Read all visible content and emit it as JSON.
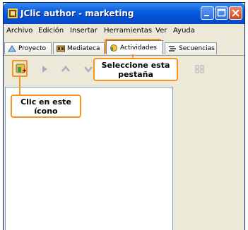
{
  "window": {
    "title": "JClic author - marketing",
    "colors": {
      "titlebar": "#0a5ee0",
      "accent": "#f7941d",
      "face": "#ece9d8"
    }
  },
  "menu": [
    "Archivo",
    "Edición",
    "Insertar",
    "Herramientas",
    "Ver",
    "Ayuda"
  ],
  "tabs": [
    {
      "label": "Proyecto",
      "icon": "project-icon",
      "active": false
    },
    {
      "label": "Mediateca",
      "icon": "media-library-icon",
      "active": false
    },
    {
      "label": "Actividades",
      "icon": "activities-icon",
      "active": true
    },
    {
      "label": "Secuencias",
      "icon": "sequences-icon",
      "active": false
    }
  ],
  "toolbar": {
    "icons": [
      "new-activity-icon",
      "play-icon",
      "move-up-icon",
      "move-down-icon",
      "grid-icon"
    ]
  },
  "annotations": {
    "tab_callout": "Seleccione esta pestaña",
    "icon_callout": "Clic en este ícono"
  }
}
